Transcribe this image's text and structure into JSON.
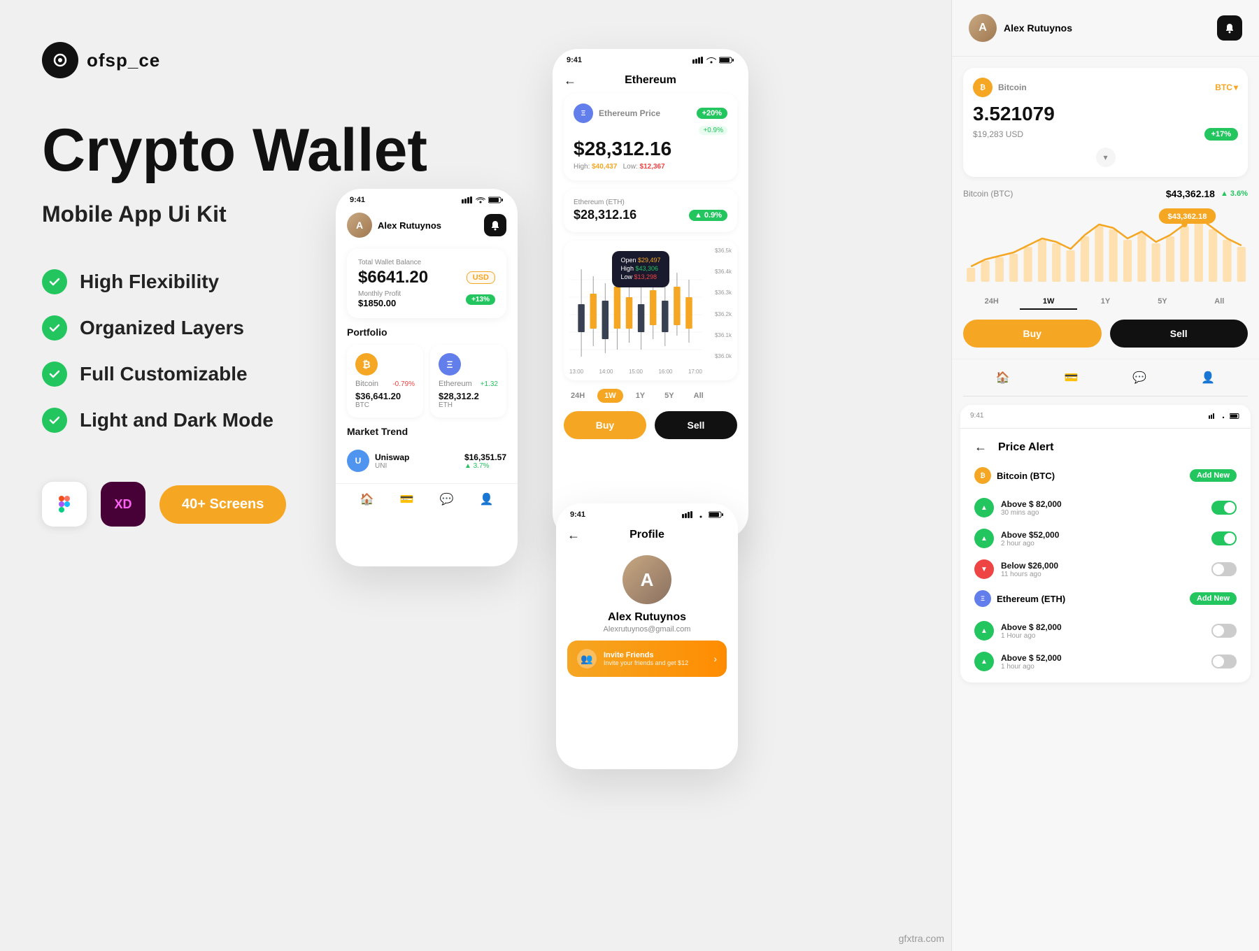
{
  "brand": {
    "name": "ofsp_ce"
  },
  "hero": {
    "title": "Crypto Wallet",
    "subtitle": "Mobile App Ui Kit"
  },
  "features": [
    {
      "id": "flexibility",
      "label": "High Flexibility"
    },
    {
      "id": "layers",
      "label": "Organized Layers"
    },
    {
      "id": "customizable",
      "label": "Full Customizable"
    },
    {
      "id": "darkmode",
      "label": "Light and Dark Mode"
    }
  ],
  "badges": {
    "screens": "40+ Screens",
    "figma": "Figma",
    "xd": "XD"
  },
  "phone1": {
    "time": "9:41",
    "user": "Alex Rutuynos",
    "wallet_label": "Total Wallet Balance",
    "currency": "USD",
    "amount": "$6641.20",
    "profit_label": "Monthly Profit",
    "profit_val": "$1850.00",
    "profit_badge": "+13%",
    "portfolio": "Portfolio",
    "btc_change": "-0.79%",
    "btc_amount": "$36,641.20",
    "btc_ticker": "BTC",
    "eth_change": "+1.32",
    "eth_amount": "$28,312.2",
    "eth_ticker": "ETH",
    "market": "Market Trend",
    "uni_name": "Uniswap",
    "uni_ticker": "UNI",
    "uni_price": "$16,351.57",
    "uni_change": "3.7%"
  },
  "phone2": {
    "time": "9:41",
    "title": "Ethereum",
    "eth_label": "Ethereum Price",
    "eth_badge": "+20%",
    "eth_badge2": "+0.9%",
    "eth_price": "$28,312.16",
    "eth_high": "$40,437",
    "eth_low": "$12,367",
    "eth_eth_label": "Ethereum (ETH)",
    "eth_eth_amount": "$28,312.16",
    "eth_eth_change": "0.9%",
    "candle_open": "$29,497",
    "candle_high": "$43,306",
    "candle_low": "$13,298",
    "y_axis": [
      "$36.5k",
      "$36.4k",
      "$36.3k",
      "$36.2k",
      "$36.1k",
      "$36.0k"
    ],
    "x_axis": [
      "13:00",
      "14:00",
      "15:00",
      "16:00",
      "17:00"
    ],
    "time_filter": [
      "24H",
      "1W",
      "1Y",
      "5Y",
      "All"
    ],
    "active_filter": "1W",
    "buy_label": "Buy",
    "sell_label": "Sell"
  },
  "phone3": {
    "time": "9:41",
    "title": "Profile",
    "name": "Alex Rutuynos",
    "email": "Alexrutuynos@gmail.com",
    "invite_title": "Invite Friends",
    "invite_sub": "Invite your friends and get $12"
  },
  "right_panel": {
    "user": "Alex Rutuynos",
    "btc_label": "Bitcoin",
    "btc_currency": "BTC",
    "btc_amount": "3.521079",
    "btc_usd": "$19,283 USD",
    "btc_change": "+17%",
    "btc_price_label": "Bitcoin (BTC)",
    "btc_price": "$43,362.18",
    "btc_price_change": "3.6%",
    "price_tag": "$43,362.18",
    "time_tabs": [
      "24H",
      "1W",
      "1Y",
      "5Y",
      "All"
    ],
    "active_tab": "1W",
    "buy_label": "Buy",
    "sell_label": "Sell",
    "price_alert": {
      "title": "Price Alert",
      "btc_label": "Bitcoin (BTC)",
      "eth_label": "Ethereum (ETH)",
      "add_new": "Add New",
      "alerts": [
        {
          "direction": "up",
          "label": "Above $ 82,000",
          "time": "30 mins ago",
          "on": true
        },
        {
          "direction": "up",
          "label": "Above $52,000",
          "time": "2 hour ago",
          "on": true
        },
        {
          "direction": "down",
          "label": "Below $26,000",
          "time": "11 hours ago",
          "on": false
        },
        {
          "direction": "up",
          "label": "Above $ 82,000",
          "time": "1 Hour ago",
          "on": false
        },
        {
          "direction": "up",
          "label": "Above $ 52,000",
          "time": "1 hour ago",
          "on": false
        }
      ]
    }
  },
  "watermark": "gfxtra.com"
}
